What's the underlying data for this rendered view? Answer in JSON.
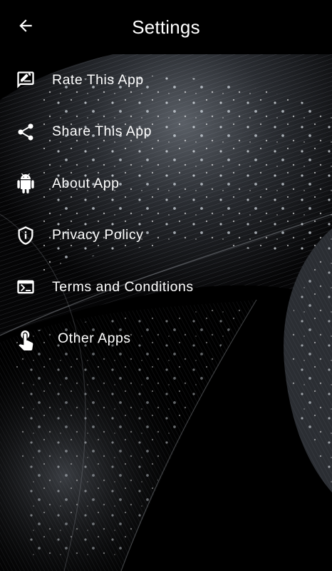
{
  "appbar": {
    "title": "Settings",
    "back_icon": "arrow-left-icon"
  },
  "menu": {
    "items": [
      {
        "label": "Rate This App",
        "icon": "rate-review-icon"
      },
      {
        "label": "Share This App",
        "icon": "share-icon"
      },
      {
        "label": "About App",
        "icon": "android-icon"
      },
      {
        "label": "Privacy Policy",
        "icon": "shield-info-icon"
      },
      {
        "label": "Terms and Conditions",
        "icon": "terminal-icon"
      },
      {
        "label": "Other Apps",
        "icon": "touch-hand-icon"
      }
    ]
  },
  "theme": {
    "background": "#000000",
    "text": "#ffffff"
  }
}
